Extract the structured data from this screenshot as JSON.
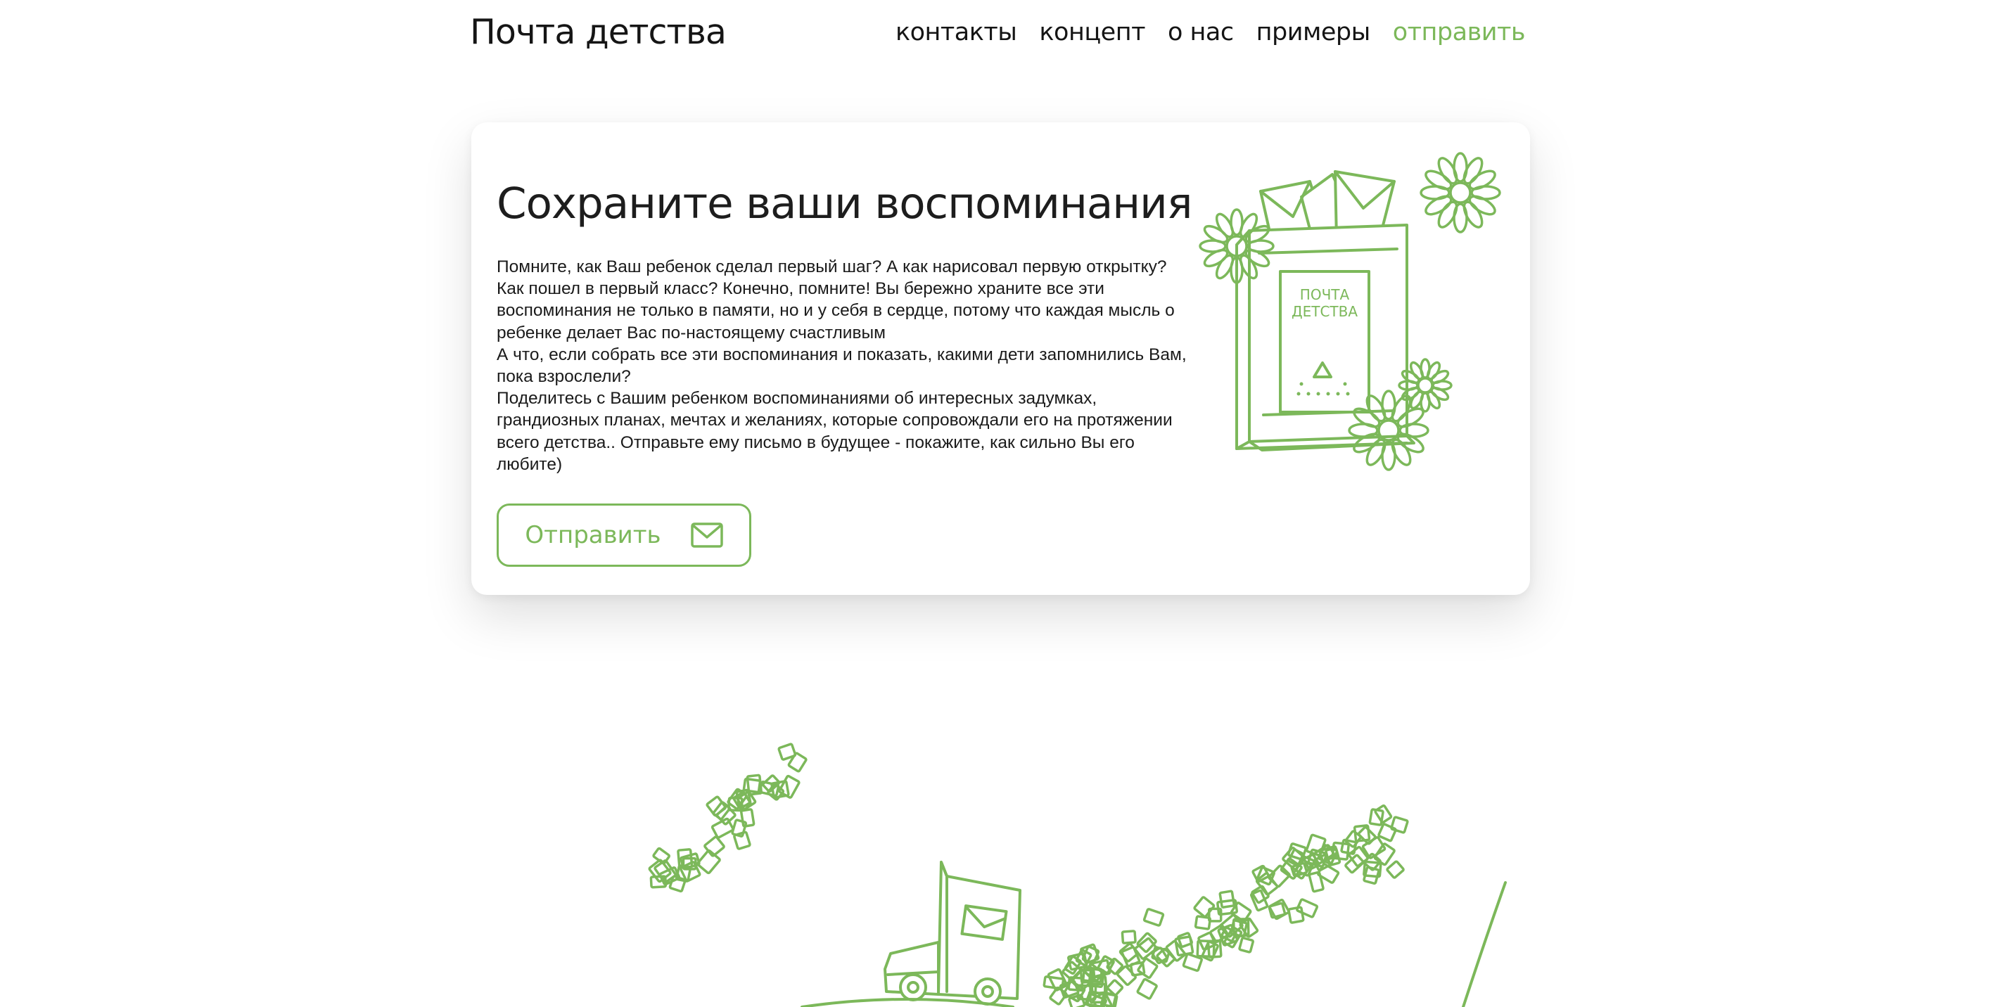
{
  "header": {
    "logo": "Почта детства",
    "nav": [
      {
        "label": "контакты"
      },
      {
        "label": "концепт"
      },
      {
        "label": "о нас"
      },
      {
        "label": "примеры"
      },
      {
        "label": "отправить",
        "accent": true
      }
    ]
  },
  "hero": {
    "title": "Сохраните ваши воспоминания",
    "paragraphs": [
      "Помните, как Ваш ребенок сделал первый шаг? А как нарисовал первую открытку? Как пошел в первый класс? Конечно, помните! Вы бережно храните все эти воспоминания не только в памяти, но и у себя в сердце, потому что каждая мысль о ребенке делает Вас по-настоящему счастливым",
      "А что, если собрать все эти воспоминания и показать, какими дети запомнились Вам, пока взрослели?",
      "Поделитесь с Вашим ребенком воспоминаниями об интересных задумках, грандиозных планах, мечтах и желаниях, которые сопровождали его на протяжении всего детства.. Отправьте ему письмо в будущее - покажите, как сильно Вы его любите)"
    ],
    "button_label": "Отправить",
    "button_icon": "envelope-icon",
    "mailbox_label": [
      "ПОЧТА",
      "ДЕТСТВА"
    ]
  },
  "illustrations": [
    "mailbox-with-flowers",
    "truck-with-letters"
  ],
  "colors": {
    "accent": "#7cb85a",
    "text": "#1a1a1a",
    "background": "#ffffff"
  }
}
